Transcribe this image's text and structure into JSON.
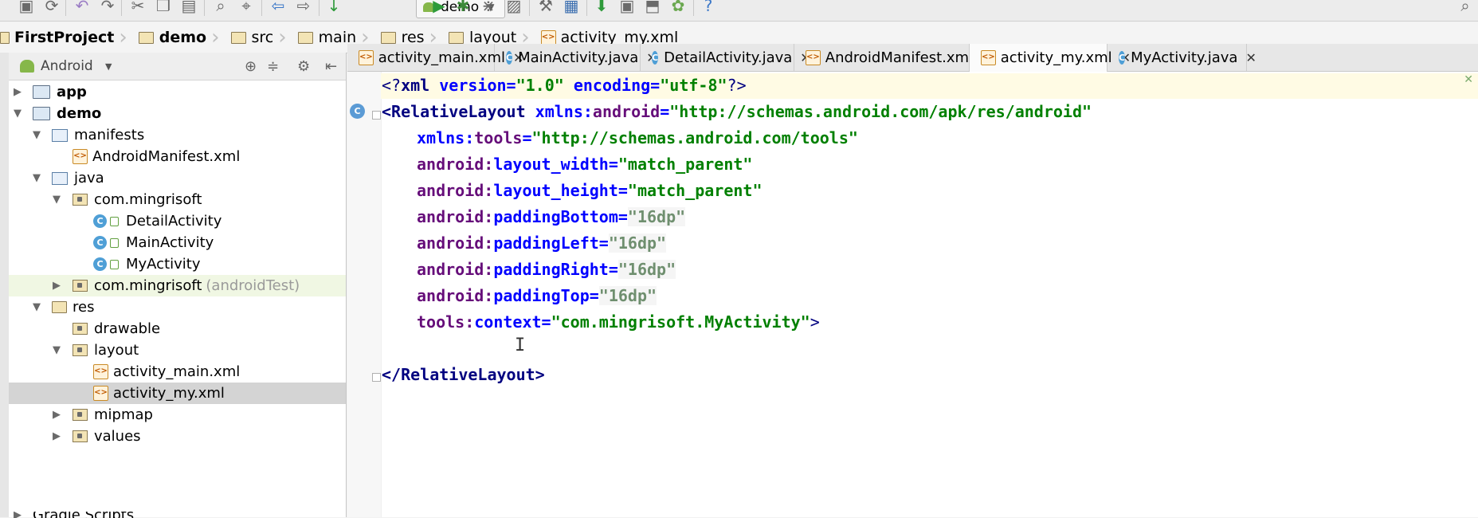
{
  "toolbar": {
    "run_config": "demo",
    "icons": [
      "save-icon",
      "sync-icon",
      "undo-icon",
      "redo-icon",
      "cut-icon",
      "copy-icon",
      "paste-icon",
      "find-icon",
      "replace-icon",
      "back-icon",
      "forward-icon",
      "make-icon",
      "run-icon",
      "debug-icon",
      "attach-debugger-icon",
      "stop-icon",
      "settings-icon",
      "project-structure-icon",
      "sdk-manager-icon",
      "avd-manager-icon",
      "android-monitor-icon",
      "help-icon"
    ]
  },
  "breadcrumb": [
    {
      "label": "FirstProject",
      "bold": true
    },
    {
      "label": "demo",
      "bold": true
    },
    {
      "label": "src"
    },
    {
      "label": "main"
    },
    {
      "label": "res"
    },
    {
      "label": "layout"
    },
    {
      "label": "activity_my.xml"
    }
  ],
  "project_panel": {
    "view_selector": "Android",
    "items": [
      {
        "label": "app"
      },
      {
        "label": "demo"
      },
      {
        "label": "manifests"
      },
      {
        "label": "AndroidManifest.xml"
      },
      {
        "label": "java"
      },
      {
        "label": "com.mingrisoft"
      },
      {
        "label": "DetailActivity"
      },
      {
        "label": "MainActivity"
      },
      {
        "label": "MyActivity"
      },
      {
        "label": "com.mingrisoft",
        "suffix": "(androidTest)"
      },
      {
        "label": "res"
      },
      {
        "label": "drawable"
      },
      {
        "label": "layout"
      },
      {
        "label": "activity_main.xml"
      },
      {
        "label": "activity_my.xml"
      },
      {
        "label": "mipmap"
      },
      {
        "label": "values"
      },
      {
        "label": "Gradle Scripts"
      }
    ]
  },
  "tabs": [
    {
      "label": "activity_main.xml"
    },
    {
      "label": "MainActivity.java"
    },
    {
      "label": "DetailActivity.java"
    },
    {
      "label": "AndroidManifest.xml"
    },
    {
      "label": "activity_my.xml",
      "active": true
    },
    {
      "label": "MyActivity.java"
    }
  ],
  "editor": {
    "lines": {
      "l1_a": "<?",
      "l1_b": "xml ",
      "l1_c": "version=",
      "l1_d": "\"1.0\"",
      "l1_e": " encoding=",
      "l1_f": "\"utf-8\"",
      "l1_g": "?>",
      "l2_a": "<RelativeLayout ",
      "l2_b": "xmlns:",
      "l2_c": "android",
      "l2_d": "=",
      "l2_e": "\"http://schemas.android.com/apk/res/android\"",
      "l3_a": "xmlns:",
      "l3_b": "tools",
      "l3_c": "=",
      "l3_d": "\"http://schemas.android.com/tools\"",
      "l4_a": "android:",
      "l4_b": "layout_width",
      "l4_c": "=",
      "l4_d": "\"match_parent\"",
      "l5_a": "android:",
      "l5_b": "layout_height",
      "l5_c": "=",
      "l5_d": "\"match_parent\"",
      "l6_a": "android:",
      "l6_b": "paddingBottom",
      "l6_c": "=",
      "l6_d": "\"16dp\"",
      "l7_a": "android:",
      "l7_b": "paddingLeft",
      "l7_c": "=",
      "l7_d": "\"16dp\"",
      "l8_a": "android:",
      "l8_b": "paddingRight",
      "l8_c": "=",
      "l8_d": "\"16dp\"",
      "l9_a": "android:",
      "l9_b": "paddingTop",
      "l9_c": "=",
      "l9_d": "\"16dp\"",
      "l10_a": "tools:",
      "l10_b": "context",
      "l10_c": "=",
      "l10_d": "\"com.mingrisoft.MyActivity\"",
      "l10_e": ">",
      "l12": "</RelativeLayout>"
    }
  },
  "colors": {
    "tag": "#000080",
    "attribute": "#0000ff",
    "value": "#008000",
    "current_line": "#fffbe4",
    "selection": "#d4d4d4"
  }
}
